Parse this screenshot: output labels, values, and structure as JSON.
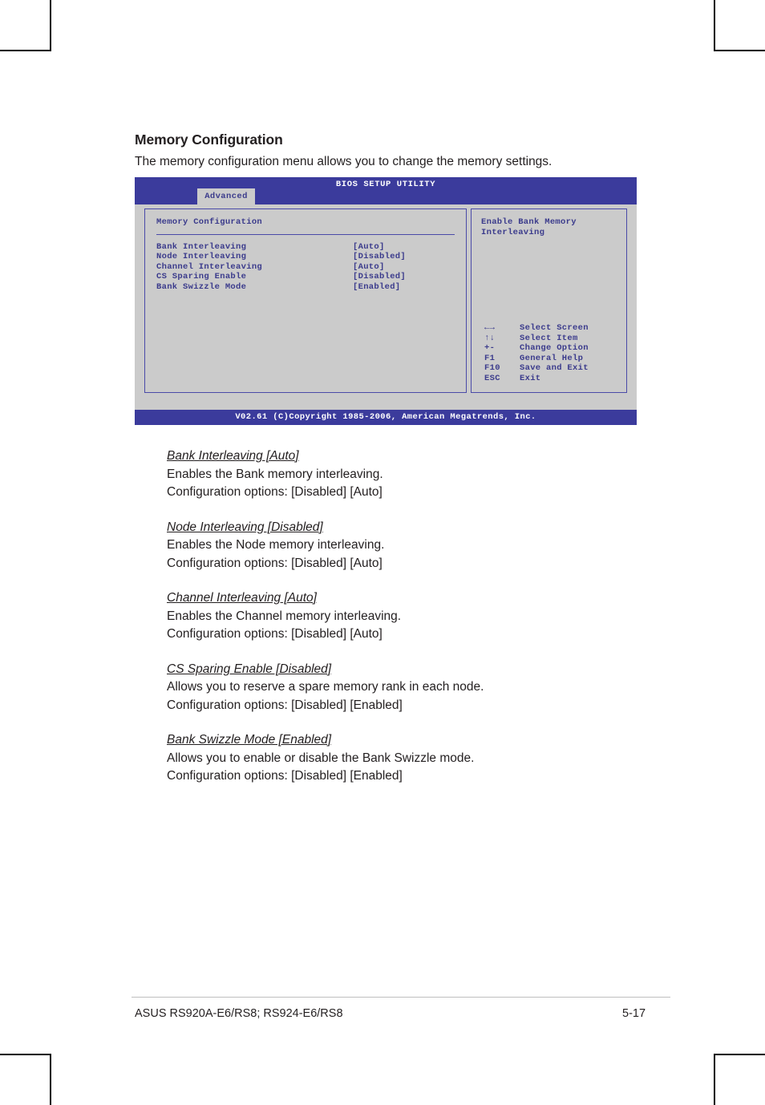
{
  "section": {
    "heading": "Memory Configuration",
    "intro": "The memory configuration menu allows you to change the memory settings."
  },
  "bios": {
    "title": "BIOS SETUP UTILITY",
    "active_tab": "Advanced",
    "panel_title": "Memory Configuration",
    "options": [
      {
        "label": "Bank Interleaving",
        "value": "[Auto]"
      },
      {
        "label": "Node Interleaving",
        "value": "[Disabled]"
      },
      {
        "label": "Channel Interleaving",
        "value": "[Auto]"
      },
      {
        "label": "CS Sparing Enable",
        "value": "[Disabled]"
      },
      {
        "label": "Bank Swizzle Mode",
        "value": "[Enabled]"
      }
    ],
    "help_text": "Enable Bank Memory Interleaving",
    "legend": [
      {
        "key": "←→",
        "desc": "Select Screen"
      },
      {
        "key": "↑↓",
        "desc": "Select Item"
      },
      {
        "key": "+-",
        "desc": "Change Option"
      },
      {
        "key": "F1",
        "desc": "General Help"
      },
      {
        "key": "F10",
        "desc": "Save and Exit"
      },
      {
        "key": "ESC",
        "desc": "Exit"
      }
    ],
    "footer": "V02.61 (C)Copyright 1985-2006, American Megatrends, Inc.",
    "colors": {
      "header_blue": "#3b3b9c",
      "panel_gray": "#cbcbcb",
      "text_blue": "#3b3b8c",
      "border_blue": "#4a4aa8"
    }
  },
  "descriptions": [
    {
      "title": "Bank Interleaving [Auto]",
      "line1": "Enables the Bank memory interleaving.",
      "line2": "Configuration options: [Disabled] [Auto]"
    },
    {
      "title": "Node Interleaving [Disabled]",
      "line1": "Enables the Node memory interleaving.",
      "line2": "Configuration options: [Disabled] [Auto]"
    },
    {
      "title": "Channel Interleaving [Auto]",
      "line1": "Enables the Channel memory interleaving.",
      "line2": "Configuration options: [Disabled] [Auto]"
    },
    {
      "title": "CS Sparing Enable [Disabled]",
      "line1": "Allows you to reserve a spare memory rank in each node.",
      "line2": "Configuration options: [Disabled] [Enabled]"
    },
    {
      "title": "Bank Swizzle Mode [Enabled]",
      "line1": "Allows you to enable or disable the Bank Swizzle mode.",
      "line2": "Configuration options: [Disabled] [Enabled]"
    }
  ],
  "page_footer": {
    "product": "ASUS RS920A-E6/RS8; RS924-E6/RS8",
    "page_number": "5-17"
  }
}
